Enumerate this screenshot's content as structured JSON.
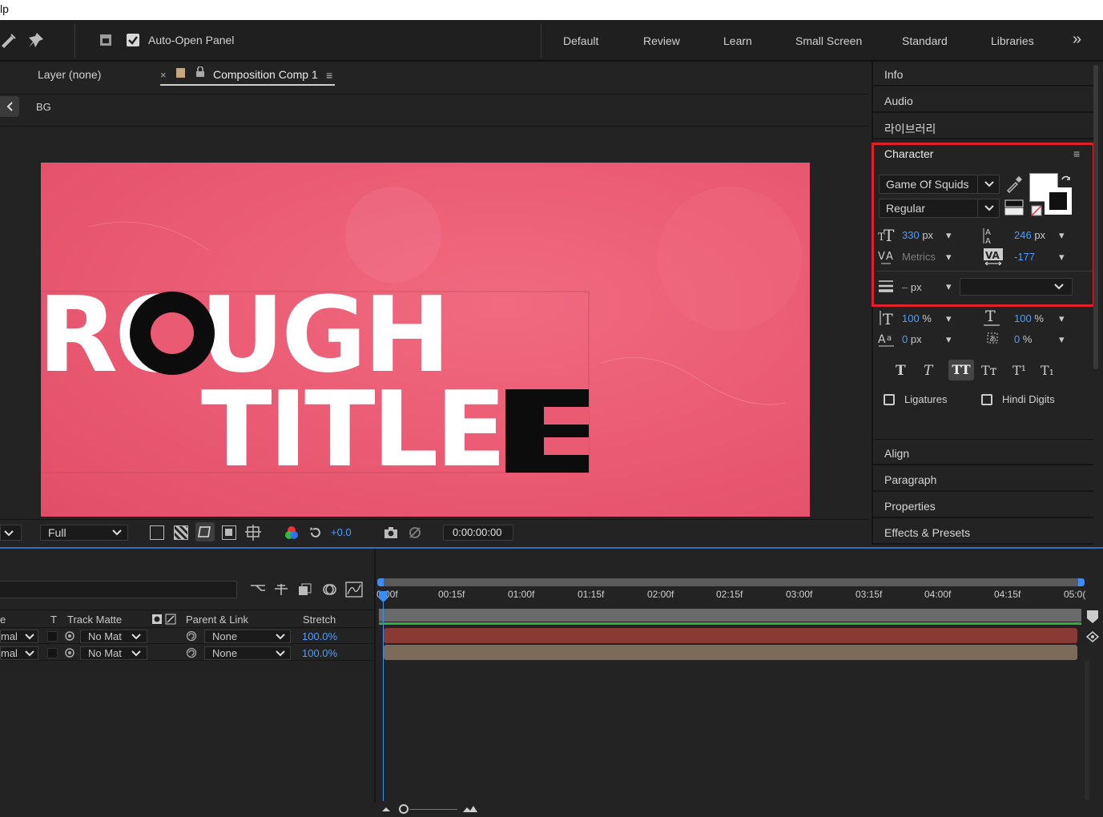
{
  "menubar": {
    "fragment": "lp"
  },
  "toolbar": {
    "auto_open_panel": "Auto-Open Panel",
    "workspaces": [
      "Default",
      "Review",
      "Learn",
      "Small Screen",
      "Standard",
      "Libraries"
    ],
    "more": "»"
  },
  "viewer": {
    "layer_tab": "Layer (none)",
    "comp_tab_close": "×",
    "comp_tab": "Composition Comp 1",
    "breadcrumb": "BG",
    "canvas_text_line1": "ROUGH",
    "canvas_text_line2": "TITLE",
    "resolution": "Full",
    "exposure": "+0.0",
    "timecode": "0:00:00:00"
  },
  "right_panel": {
    "info": "Info",
    "audio": "Audio",
    "libraries_kr": "라이브러리",
    "character": "Character",
    "font_family": "Game Of Squids",
    "font_style": "Regular",
    "font_size": "330",
    "font_size_unit": "px",
    "leading": "246",
    "leading_unit": "px",
    "kerning": "Metrics",
    "tracking": "-177",
    "stroke_width": "–",
    "stroke_unit": "px",
    "vert_scale": "100",
    "horiz_scale": "100",
    "pct": "%",
    "baseline_shift": "0",
    "baseline_unit": "px",
    "tsume": "0",
    "ligatures": "Ligatures",
    "hindi_digits": "Hindi Digits",
    "align": "Align",
    "paragraph": "Paragraph",
    "properties": "Properties",
    "effects_presets": "Effects & Presets",
    "style_buttons": [
      "T",
      "T",
      "TT",
      "Tт",
      "T¹",
      "T₁"
    ]
  },
  "timeline": {
    "col_mode_fragment": "e",
    "col_t": "T",
    "col_track_matte": "Track Matte",
    "col_parent": "Parent & Link",
    "col_stretch": "Stretch",
    "rows": [
      {
        "mode": "mal",
        "matte": "No Mat",
        "parent": "None",
        "stretch": "100.0%"
      },
      {
        "mode": "mal",
        "matte": "No Mat",
        "parent": "None",
        "stretch": "100.0%"
      }
    ],
    "ticks": [
      "0:00f",
      "00:15f",
      "01:00f",
      "01:15f",
      "02:00f",
      "02:15f",
      "03:00f",
      "03:15f",
      "04:00f",
      "04:15f",
      "05:0("
    ]
  },
  "colors": {
    "accent_blue": "#4a9dff",
    "highlight_red": "#e0202a",
    "canvas_pink": "#ea5a72",
    "layer_bar_red": "#8a3a35",
    "layer_bar_tan": "#7d6b5a"
  }
}
